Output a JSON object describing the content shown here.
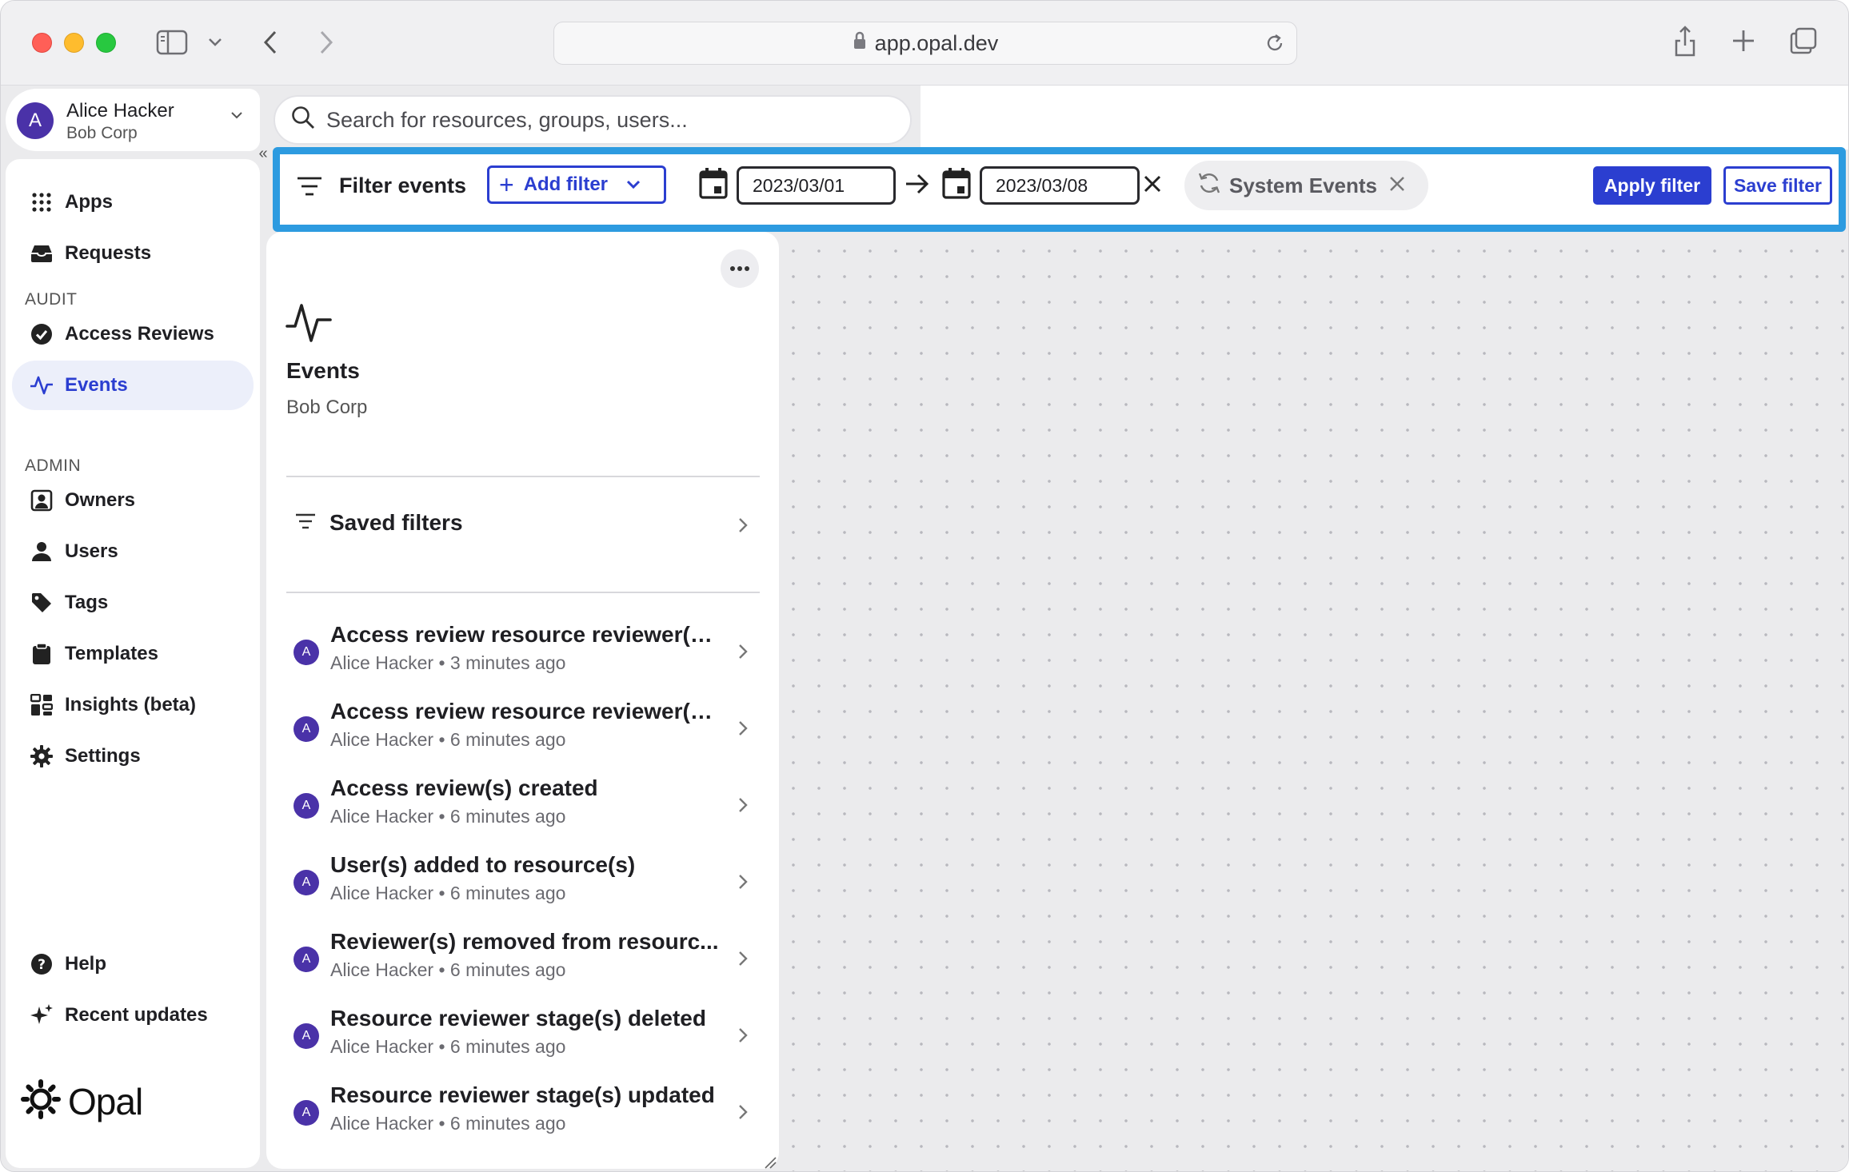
{
  "browser": {
    "url": "app.opal.dev"
  },
  "account": {
    "initial": "A",
    "name": "Alice Hacker",
    "org": "Bob Corp"
  },
  "sidebar": {
    "items_top": [
      {
        "label": "Apps",
        "icon": "grid-icon"
      },
      {
        "label": "Requests",
        "icon": "inbox-icon"
      }
    ],
    "audit_label": "AUDIT",
    "items_audit": [
      {
        "label": "Access Reviews",
        "icon": "check-circle-icon"
      },
      {
        "label": "Events",
        "icon": "pulse-icon",
        "active": true
      }
    ],
    "admin_label": "ADMIN",
    "items_admin": [
      {
        "label": "Owners",
        "icon": "owner-icon"
      },
      {
        "label": "Users",
        "icon": "user-icon"
      },
      {
        "label": "Tags",
        "icon": "tag-icon"
      },
      {
        "label": "Templates",
        "icon": "clipboard-icon"
      },
      {
        "label": "Insights (beta)",
        "icon": "insights-icon"
      },
      {
        "label": "Settings",
        "icon": "gear-icon"
      }
    ],
    "items_bottom": [
      {
        "label": "Help",
        "icon": "help-icon"
      },
      {
        "label": "Recent updates",
        "icon": "sparkle-icon"
      }
    ],
    "logo_text": "Opal"
  },
  "search": {
    "placeholder": "Search for resources, groups, users..."
  },
  "filter_bar": {
    "title": "Filter events",
    "add_filter_label": "Add filter",
    "start_date": "2023/03/01",
    "end_date": "2023/03/08",
    "chip_label": "System Events",
    "apply_label": "Apply filter",
    "save_label": "Save filter"
  },
  "panel": {
    "title": "Events",
    "subtitle": "Bob Corp",
    "saved_filters_label": "Saved filters",
    "events": [
      {
        "initial": "A",
        "title": "Access review resource reviewer(s)...",
        "meta": "Alice Hacker • 3 minutes ago"
      },
      {
        "initial": "A",
        "title": "Access review resource reviewer(s)...",
        "meta": "Alice Hacker • 6 minutes ago"
      },
      {
        "initial": "A",
        "title": "Access review(s) created",
        "meta": "Alice Hacker • 6 minutes ago"
      },
      {
        "initial": "A",
        "title": "User(s) added to resource(s)",
        "meta": "Alice Hacker • 6 minutes ago"
      },
      {
        "initial": "A",
        "title": "Reviewer(s) removed from resourc...",
        "meta": "Alice Hacker • 6 minutes ago"
      },
      {
        "initial": "A",
        "title": "Resource reviewer stage(s) deleted",
        "meta": "Alice Hacker • 6 minutes ago"
      },
      {
        "initial": "A",
        "title": "Resource reviewer stage(s) updated",
        "meta": "Alice Hacker • 6 minutes ago"
      }
    ]
  },
  "colors": {
    "accent": "#2b3ed0",
    "highlight_border": "#2d9be0",
    "avatar": "#4a32a8"
  }
}
